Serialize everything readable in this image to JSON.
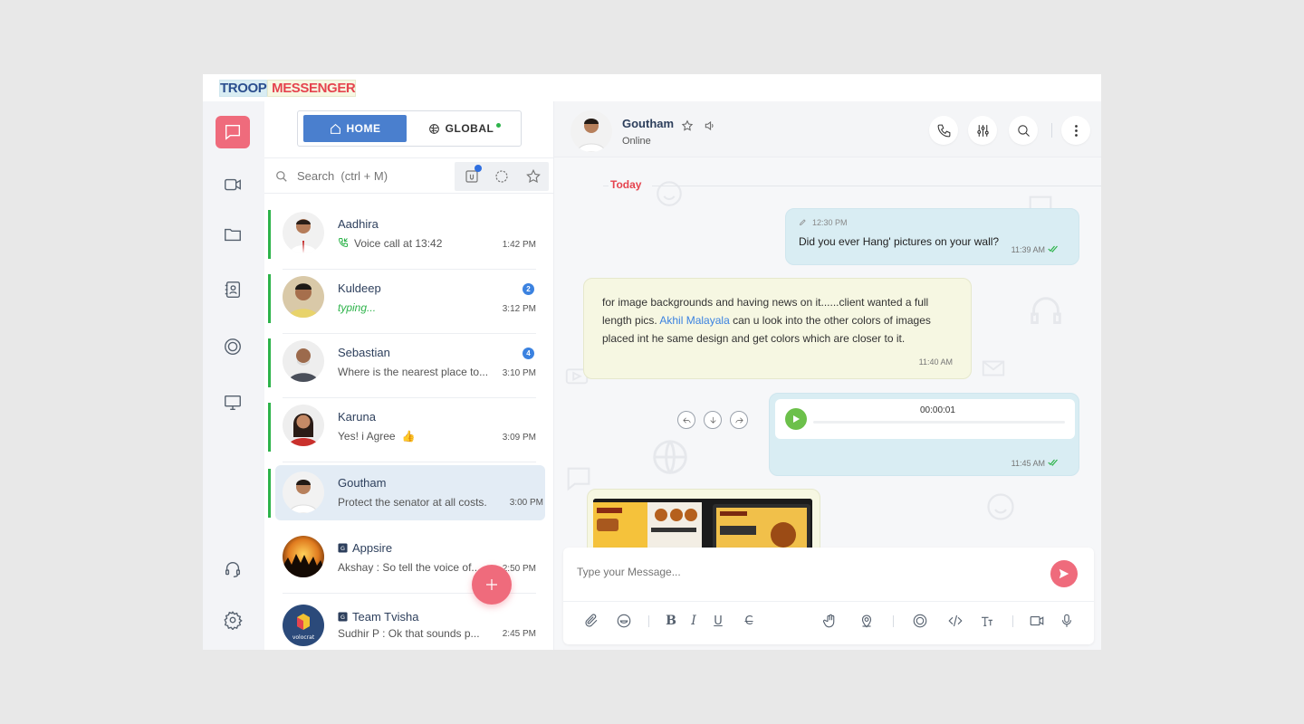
{
  "brand": {
    "part1": "TROOP",
    "part2": " MESSENGER"
  },
  "toggle": {
    "home": "HOME",
    "global": "GLOBAL"
  },
  "search": {
    "placeholder": "Search  (ctrl + M)"
  },
  "chats": [
    {
      "name": "Aadhira",
      "preview": "Voice call at 13:42",
      "time": "1:42 PM",
      "icon": "phone-incoming-icon"
    },
    {
      "name": "Kuldeep",
      "preview": "typing...",
      "time": "3:12 PM",
      "unread": "2"
    },
    {
      "name": "Sebastian",
      "preview": "Where is the nearest place to...",
      "time": "3:10 PM",
      "unread": "4"
    },
    {
      "name": "Karuna",
      "preview": "Yes! i Agree",
      "time": "3:09 PM",
      "icon": "thumbs-up-emoji"
    },
    {
      "name": "Goutham",
      "preview": "Protect the senator at all costs.",
      "time": "3:00 PM",
      "selected": true
    },
    {
      "name": "Appsire",
      "preview": "Akshay  : So tell the voice of...",
      "time": "2:50 PM",
      "group": true
    },
    {
      "name": "Team Tvisha",
      "preview": "Sudhir P : Ok that sounds p...",
      "time": "2:45 PM",
      "group": true
    }
  ],
  "conversation": {
    "contact_name": "Goutham",
    "status": "Online",
    "date_label": "Today",
    "messages": [
      {
        "edited": "12:30 PM",
        "text": "Did you ever Hang' pictures on your wall?",
        "time": "11:39 AM"
      },
      {
        "text_before": "for image backgrounds and having news on it......client wanted a full length pics. ",
        "mention": "Akhil Malayala",
        "text_after": " can u look into the other colors of images placed int he same design and get colors which are closer to it.",
        "time": "11:40 AM"
      },
      {
        "duration": "00:00:01",
        "time": "11:45 AM"
      }
    ]
  },
  "composer": {
    "placeholder": "Type your Message..."
  },
  "colors": {
    "accent": "#ef6b7c",
    "primary": "#4a7fce",
    "online": "#2db34a",
    "brand_blue": "#2c4f8f",
    "brand_red": "#e5444f"
  }
}
